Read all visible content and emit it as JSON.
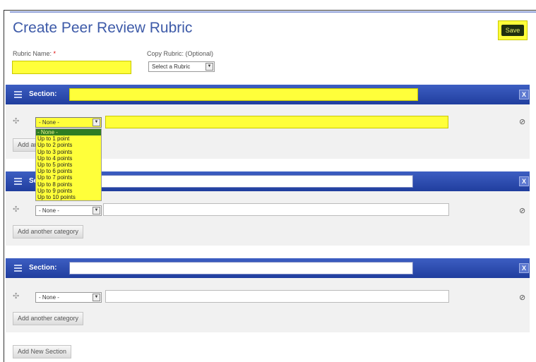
{
  "page": {
    "title": "Create Peer Review Rubric",
    "save_label": "Save"
  },
  "rubric_name": {
    "label": "Rubric Name:",
    "required_mark": "*",
    "value": ""
  },
  "copy_rubric": {
    "label": "Copy Rubric: (Optional)",
    "selected": "Select a Rubric"
  },
  "sections": [
    {
      "label": "Section:",
      "title_value": "",
      "close_label": "X",
      "category": {
        "points_selected": "- None -",
        "text_value": ""
      },
      "add_category_label": "Add another category"
    },
    {
      "label": "Section:",
      "title_value": "",
      "close_label": "X",
      "category": {
        "points_selected": "- None -",
        "text_value": ""
      },
      "add_category_label": "Add another category"
    },
    {
      "label": "Section:",
      "title_value": "",
      "close_label": "X",
      "category": {
        "points_selected": "- None -",
        "text_value": ""
      },
      "add_category_label": "Add another category"
    }
  ],
  "points_dropdown": {
    "open": true,
    "options": [
      "- None -",
      "Up to 1 point",
      "Up to 2 points",
      "Up to 3 points",
      "Up to 4 points",
      "Up to 5 points",
      "Up to 6 points",
      "Up to 7 points",
      "Up to 8 points",
      "Up to 9 points",
      "Up to 10 points"
    ],
    "selected_index": 0
  },
  "add_section_label": "Add New Section",
  "icons": {
    "drag": "drag-handle-icon",
    "delete": "delete-icon",
    "section_handle": "section-handle-icon"
  },
  "colors": {
    "title": "#3d5aa8",
    "section_bar": "#2a48b0",
    "highlight": "#ffff3a",
    "selected_option": "#2e7d23"
  }
}
